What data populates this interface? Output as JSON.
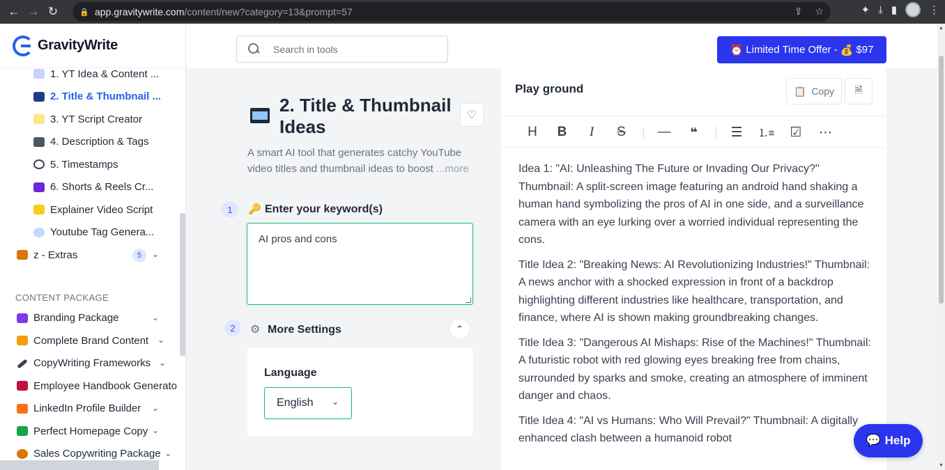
{
  "browser": {
    "url_host": "app.gravitywrite.com",
    "url_path": "/content/new?category=13&prompt=57"
  },
  "brand": {
    "name": "GravityWrite",
    "accent": "#2563eb"
  },
  "sidebar": {
    "items": [
      {
        "label": "1. YT Idea & Content ..."
      },
      {
        "label": "2. Title & Thumbnail ...",
        "active": true
      },
      {
        "label": "3. YT Script Creator"
      },
      {
        "label": "4. Description & Tags"
      },
      {
        "label": "5. Timestamps"
      },
      {
        "label": "6. Shorts & Reels Cr..."
      },
      {
        "label": "Explainer Video Script"
      },
      {
        "label": "Youtube Tag Genera..."
      }
    ],
    "extras": {
      "label": "z - Extras",
      "count": "5"
    },
    "section_title": "CONTENT PACKAGE",
    "packages": [
      {
        "label": "Branding Package"
      },
      {
        "label": "Complete Brand Content"
      },
      {
        "label": "CopyWriting Frameworks"
      },
      {
        "label": "Employee Handbook Generato"
      },
      {
        "label": "LinkedIn Profile Builder"
      },
      {
        "label": "Perfect Homepage Copy"
      },
      {
        "label": "Sales Copywriting Package"
      }
    ]
  },
  "search": {
    "placeholder": "Search in tools"
  },
  "offer": {
    "label": "Limited Time Offer -",
    "price": "$97"
  },
  "tool": {
    "title": "2. Title & Thumbnail Ideas",
    "desc": "A smart AI tool that generates catchy YouTube video titles and thumbnail ideas to boost",
    "more": "...more"
  },
  "steps": {
    "one": {
      "num": "1",
      "label": "Enter your keyword(s)",
      "value": "AI pros and cons"
    },
    "two": {
      "num": "2",
      "label": "More Settings"
    }
  },
  "settings": {
    "language_label": "Language",
    "language_value": "English"
  },
  "playground": {
    "title": "Play ground",
    "copy_label": "Copy",
    "paragraphs": [
      "Idea 1: \"AI: Unleashing The Future or Invading Our Privacy?\" Thumbnail: A split-screen image featuring an android hand shaking a human hand symbolizing the pros of AI in one side, and a surveillance camera with an eye lurking over a worried individual representing the cons.",
      "Title Idea 2: \"Breaking News: AI Revolutionizing Industries!\" Thumbnail: A news anchor with a shocked expression in front of a backdrop highlighting different industries like healthcare, transportation, and finance, where AI is shown making groundbreaking changes.",
      "Title Idea 3: \"Dangerous AI Mishaps: Rise of the Machines!\" Thumbnail: A futuristic robot with red glowing eyes breaking free from chains, surrounded by sparks and smoke, creating an atmosphere of imminent danger and chaos.",
      "Title Idea 4: \"AI vs Humans: Who Will Prevail?\" Thumbnail: A digitally enhanced clash between a humanoid robot"
    ]
  },
  "help": {
    "label": "Help"
  }
}
